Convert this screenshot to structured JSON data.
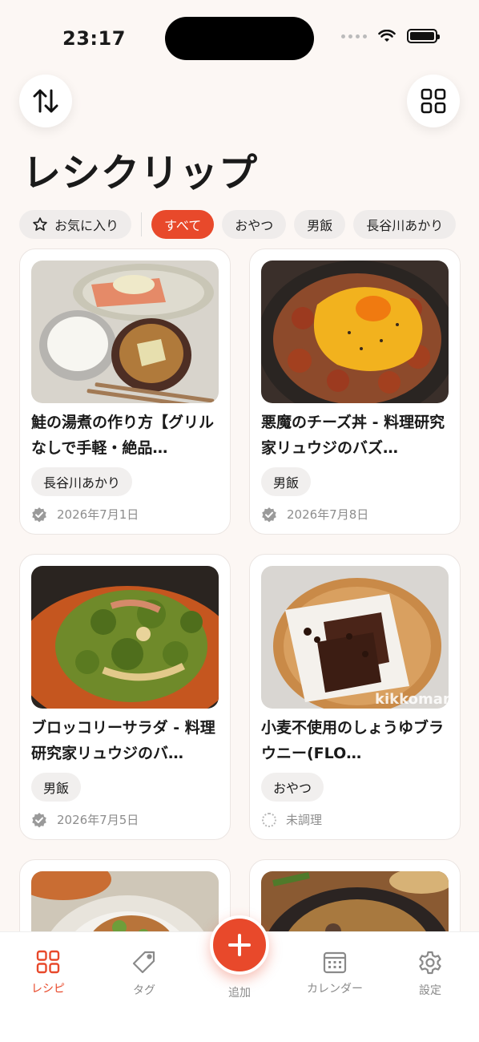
{
  "status_bar": {
    "time": "23:17"
  },
  "header": {
    "title": "レシクリップ"
  },
  "filters": {
    "favorite_label": "お気に入り",
    "chips": [
      "すべて",
      "おやつ",
      "男飯",
      "長谷川あかり"
    ]
  },
  "recipes": [
    {
      "title": "鮭の湯煮の作り方【グリルなしで手軽・絶品…",
      "tag": "長谷川あかり",
      "meta": "2026年7月1日",
      "status": "done"
    },
    {
      "title": "悪魔のチーズ丼 - 料理研究家リュウジのバズ…",
      "tag": "男飯",
      "meta": "2026年7月8日",
      "status": "done"
    },
    {
      "title": "ブロッコリーサラダ - 料理研究家リュウジのバ…",
      "tag": "男飯",
      "meta": "2026年7月5日",
      "status": "done"
    },
    {
      "title": "小麦不使用のしょうゆブラウニー(FLO…",
      "tag": "おやつ",
      "meta": "未調理",
      "status": "pending",
      "image_watermark": "kikkoman"
    }
  ],
  "tabbar": {
    "recipes": "レシピ",
    "tags": "タグ",
    "add": "追加",
    "calendar": "カレンダー",
    "settings": "設定"
  },
  "colors": {
    "accent": "#e8492b",
    "background": "#fcf7f4"
  }
}
